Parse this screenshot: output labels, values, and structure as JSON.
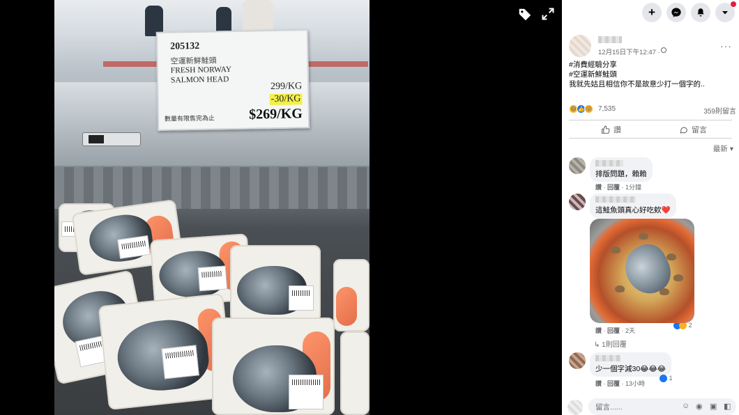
{
  "photo": {
    "sign": {
      "code": "205132",
      "name_zh": "空運新鮮鮭頭",
      "name_en_line1": "FRESH NORWAY",
      "name_en_line2": "SALMON HEAD",
      "price_original": "299/KG",
      "discount": "-30/KG",
      "note": "數量有限售完為止",
      "price_final": "$269/KG"
    }
  },
  "viewer_icons": {
    "tag": "tag-icon",
    "fullscreen": "expand-icon"
  },
  "topbar": {
    "create": "+",
    "messenger": "messenger-icon",
    "notifications": "bell-icon",
    "account": "caret-down-icon"
  },
  "post": {
    "time": "12月15日下午12:47 · ",
    "more": "···",
    "text_lines": [
      "#消費經驗分享",
      "#空運新鮮鮭頭",
      "我就先姑且相信你不是故意少打一個字的.."
    ],
    "reaction_count": "7,535",
    "comment_count": "359則留言",
    "like_label": "讚",
    "comment_label": "留言",
    "sort_label": "最新 ▾"
  },
  "comments": [
    {
      "text": "排版問題，賴賴",
      "meta": {
        "like": "讚",
        "reply": "回覆",
        "time": "1分鐘"
      }
    },
    {
      "text": "這鮭魚頭真心好吃欸❤️",
      "meta": {
        "like": "讚",
        "reply": "回覆",
        "time": "2天"
      },
      "reactions": "2",
      "replies_link": "↳ 1則回覆"
    },
    {
      "text": "少一個字減30😂😂😂",
      "meta": {
        "like": "讚",
        "reply": "回覆",
        "time": "13小時"
      },
      "reactions": "1"
    }
  ],
  "composer": {
    "placeholder": "留言......"
  },
  "colors": {
    "facebook_blue": "#1877f2",
    "notification_red": "#e41e3f",
    "bubble_gray": "#f0f2f5"
  }
}
